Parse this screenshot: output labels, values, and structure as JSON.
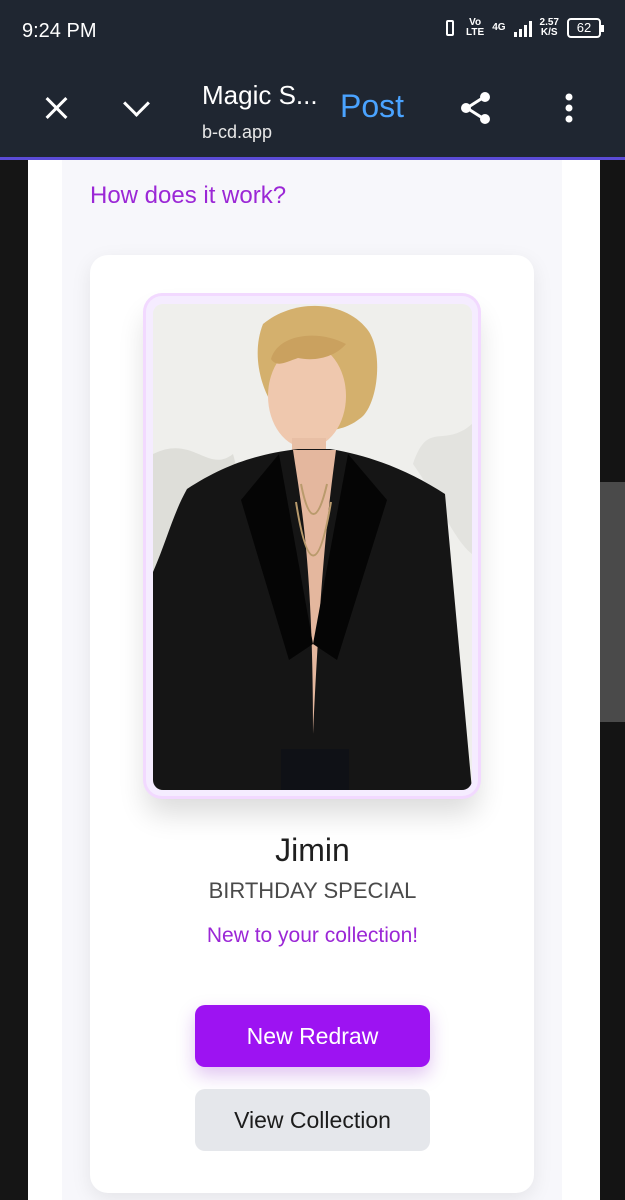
{
  "status_bar": {
    "time": "9:24 PM",
    "vo": "Vo",
    "lte": "LTE",
    "network": "4G",
    "speed": "2.57",
    "speed_unit": "K/S",
    "battery": "62"
  },
  "toolbar": {
    "title": "Magic S...",
    "url": "b-cd.app",
    "post_label": "Post"
  },
  "page": {
    "how_link": "How does it work?",
    "card": {
      "name": "Jimin",
      "subtitle": "BIRTHDAY SPECIAL",
      "message": "New to your collection!",
      "primary_button": "New Redraw",
      "secondary_button": "View Collection"
    }
  },
  "colors": {
    "purple_text": "#9b27d6",
    "primary_button": "#9d13f2",
    "post_blue": "#4aa3ff"
  },
  "icons": {
    "close": "close-icon",
    "collapse": "chevron-down-icon",
    "share": "share-icon",
    "more": "more-vert-icon"
  }
}
